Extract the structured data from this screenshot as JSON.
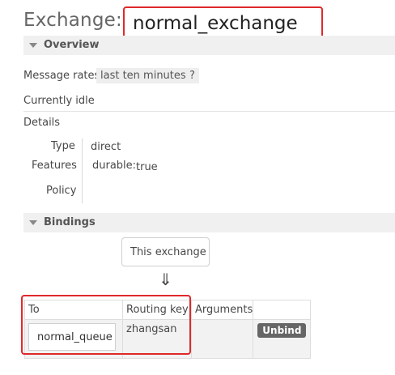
{
  "header": {
    "title_prefix": "Exchange:",
    "exchange_name": "normal_exchange"
  },
  "overview": {
    "section_label": "Overview",
    "message_rates_label": "Message rates",
    "rate_window": "last ten minutes",
    "help": "?",
    "status": "Currently idle",
    "details_label": "Details",
    "type_label": "Type",
    "type_value": "direct",
    "features_label": "Features",
    "feature_key": "durable:",
    "feature_value": "true",
    "policy_label": "Policy"
  },
  "bindings": {
    "section_label": "Bindings",
    "this_exchange": "This exchange",
    "arrow": "⇓",
    "columns": [
      "To",
      "Routing key",
      "Arguments",
      ""
    ],
    "rows": [
      {
        "to": "normal_queue",
        "routing_key": "zhangsan",
        "arguments": "",
        "action": "Unbind"
      }
    ]
  },
  "colors": {
    "highlight": "#e0292a",
    "header_bg": "#f0f0f0",
    "unbind_bg": "#666666"
  }
}
